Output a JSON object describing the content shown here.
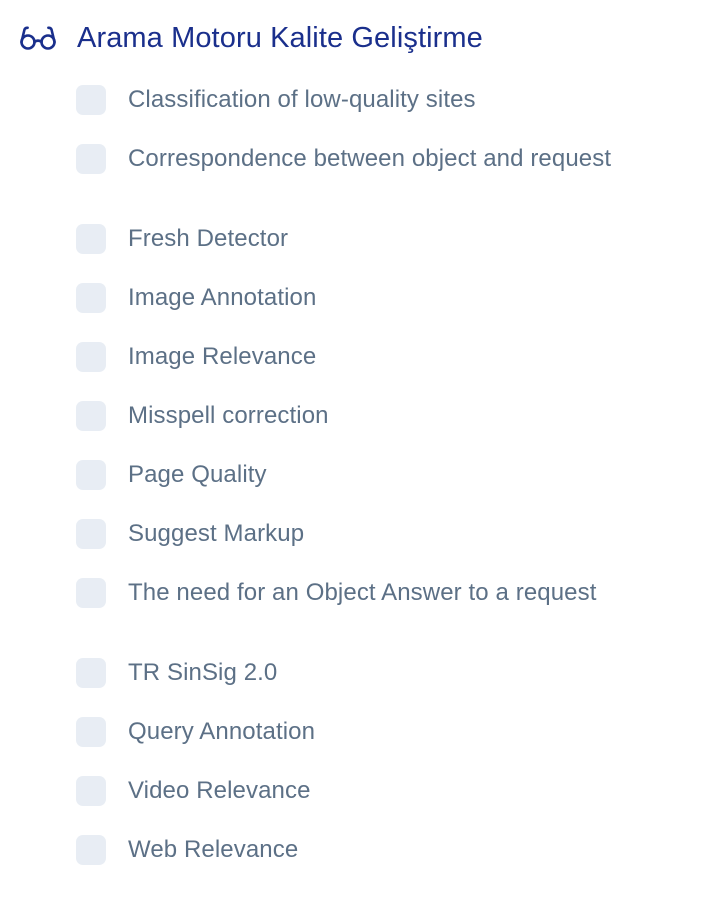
{
  "group": {
    "icon": "glasses-icon",
    "title": "Arama Motoru Kalite Geliştirme",
    "title_color": "#1a2f8c"
  },
  "checkbox_color": "#e8edf4",
  "label_color": "#5c7086",
  "items": [
    {
      "label": "Classification of low-quality sites",
      "checked": false
    },
    {
      "label": "Correspondence between object and request",
      "checked": false
    },
    {
      "label": "Fresh Detector",
      "checked": false
    },
    {
      "label": "Image Annotation",
      "checked": false
    },
    {
      "label": "Image Relevance",
      "checked": false
    },
    {
      "label": "Misspell correction",
      "checked": false
    },
    {
      "label": "Page Quality",
      "checked": false
    },
    {
      "label": "Suggest Markup",
      "checked": false
    },
    {
      "label": "The need for an Object Answer to a request",
      "checked": false
    },
    {
      "label": "TR SinSig 2.0",
      "checked": false
    },
    {
      "label": "Query Annotation",
      "checked": false
    },
    {
      "label": "Video Relevance",
      "checked": false
    },
    {
      "label": "Web Relevance",
      "checked": false
    }
  ]
}
